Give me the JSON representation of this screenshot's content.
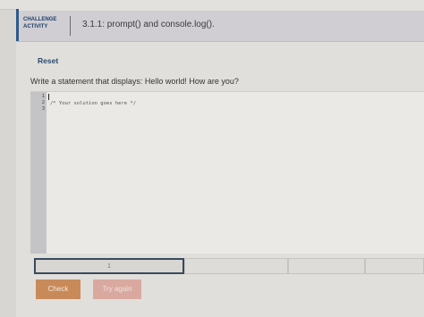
{
  "header": {
    "badge_line1": "CHALLENGE",
    "badge_line2": "ACTIVITY",
    "title": "3.1.1: prompt() and console.log()."
  },
  "actions": {
    "reset_label": "Reset",
    "check_label": "Check",
    "try_again_label": "Try again"
  },
  "instructions": "Write a statement that displays: Hello world! How are you?",
  "editor": {
    "line_numbers": [
      "1",
      "2",
      "3"
    ],
    "line2_code": "/* Your solution goes here */"
  },
  "progress": {
    "current_step": "1",
    "segments": [
      "1",
      "",
      "",
      ""
    ]
  },
  "colors": {
    "accent": "#2e5a8a",
    "check_button": "#c98a5a",
    "try_again_button": "#d9a9a0"
  }
}
